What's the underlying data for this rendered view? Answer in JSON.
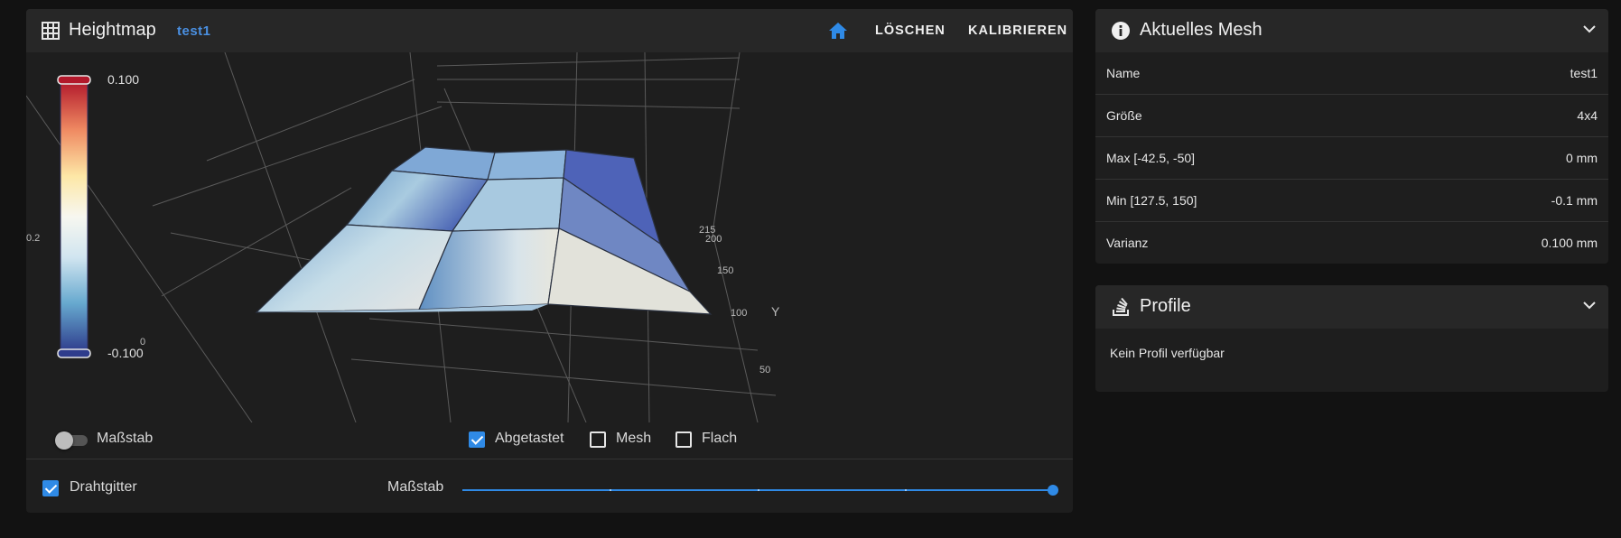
{
  "heightmap": {
    "title": "Heightmap",
    "profile": "test1",
    "buttons": {
      "home_icon": "home-icon",
      "clear": "LÖSCHEN",
      "calibrate": "KALIBRIEREN"
    },
    "colorbar": {
      "max": "0.100",
      "min": "-0.100",
      "colors": [
        "#b2182b",
        "#ef8a62",
        "#fddbc7",
        "#f7f7f7",
        "#d1e5f0",
        "#67a9cf",
        "#2e3c8c"
      ]
    },
    "axis": {
      "y_label": "Y",
      "y_ticks": [
        "215",
        "200",
        "150",
        "100",
        "50"
      ],
      "z_tick_a": "0.2",
      "z_tick_b": "0"
    },
    "controls": {
      "scale_toggle_label": "Maßstab",
      "scale_toggle_on": false,
      "probed_label": "Abgetastet",
      "probed_checked": true,
      "mesh_label": "Mesh",
      "mesh_checked": false,
      "flat_label": "Flach",
      "flat_checked": false,
      "wireframe_label": "Drahtgitter",
      "wireframe_checked": true,
      "scale_slider_label": "Maßstab",
      "scale_slider_value": 1.0
    }
  },
  "current_mesh": {
    "title": "Aktuelles Mesh",
    "rows": [
      {
        "key": "Name",
        "value": "test1"
      },
      {
        "key": "Größe",
        "value": "4x4"
      },
      {
        "key": "Max [-42.5, -50]",
        "value": "0 mm"
      },
      {
        "key": "Min [127.5, 150]",
        "value": "-0.1 mm"
      },
      {
        "key": "Varianz",
        "value": "0.100 mm"
      }
    ]
  },
  "profiles": {
    "title": "Profile",
    "empty_text": "Kein Profil verfügbar"
  }
}
